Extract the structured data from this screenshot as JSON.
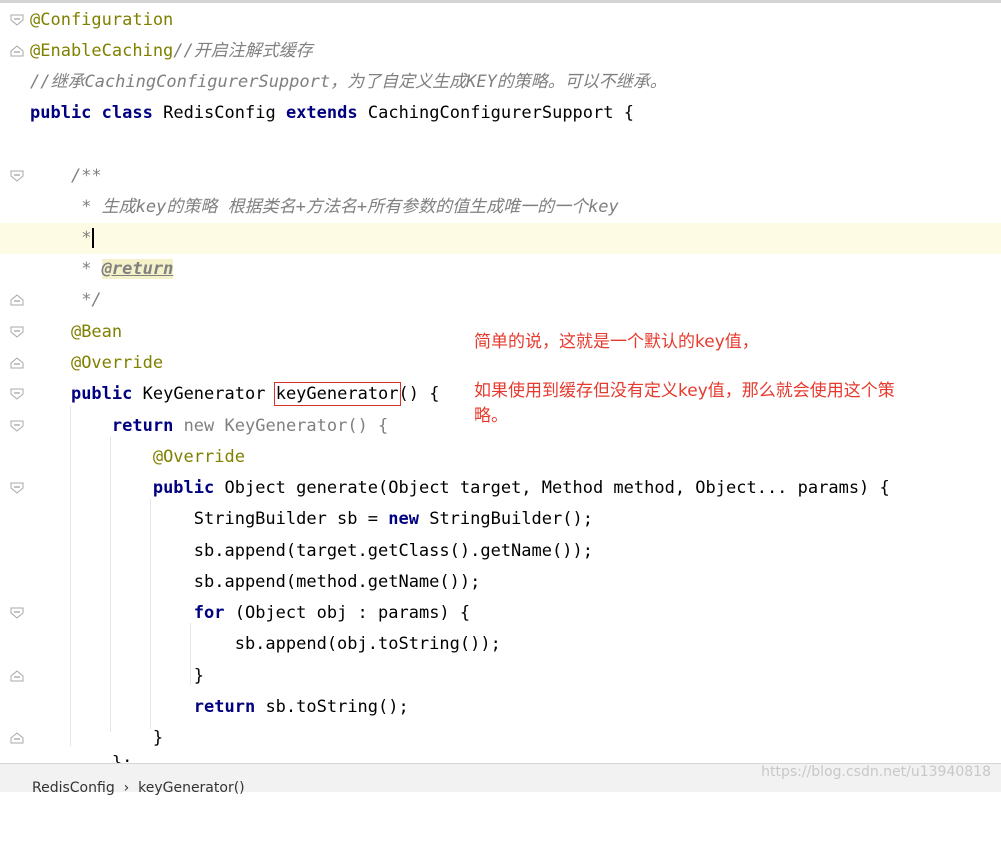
{
  "code_lines": [
    {
      "text": "@Configuration"
    },
    {
      "text": "@EnableCaching//开启注解式缓存"
    },
    {
      "text": "//继承CachingConfigurerSupport，为了自定义生成KEY的策略。可以不继承。"
    },
    {
      "text": "public class RedisConfig extends CachingConfigurerSupport {"
    },
    {
      "text": ""
    },
    {
      "text": "    /**"
    },
    {
      "text": "     * 生成key的策略 根据类名+方法名+所有参数的值生成唯一的一个key"
    },
    {
      "text": "     *"
    },
    {
      "text": "     * @return"
    },
    {
      "text": "     */"
    },
    {
      "text": "    @Bean"
    },
    {
      "text": "    @Override"
    },
    {
      "text": "    public KeyGenerator keyGenerator() {"
    },
    {
      "text": "        return new KeyGenerator() {"
    },
    {
      "text": "            @Override"
    },
    {
      "text": "            public Object generate(Object target, Method method, Object... params) {"
    },
    {
      "text": "                StringBuilder sb = new StringBuilder();"
    },
    {
      "text": "                sb.append(target.getClass().getName());"
    },
    {
      "text": "                sb.append(method.getName());"
    },
    {
      "text": "                for (Object obj : params) {"
    },
    {
      "text": "                    sb.append(obj.toString());"
    },
    {
      "text": "                }"
    },
    {
      "text": "                return sb.toString();"
    },
    {
      "text": "            }"
    },
    {
      "text": "        };"
    }
  ],
  "tokens": {
    "l1_annot": "@Configuration",
    "l2_annot": "@EnableCaching",
    "l2_comment": "//开启注解式缓存",
    "l3_comment": "//继承CachingConfigurerSupport，为了自定义生成KEY的策略。可以不继承。",
    "kw_public": "public",
    "kw_class": "class",
    "kw_extends": "extends",
    "kw_return": "return",
    "kw_new": "new",
    "kw_for": "for",
    "class_name": "RedisConfig",
    "super_name": "CachingConfigurerSupport",
    "brace_open": " {",
    "doc_open": "/**",
    "doc_line1": "* 生成key的策略 根据类名+方法名+所有参数的值生成唯一的一个key",
    "doc_star": "*",
    "doc_tag": "@return",
    "doc_close": "*/",
    "ann_bean": "@Bean",
    "ann_override": "@Override",
    "type_keygen": "KeyGenerator",
    "method_keygen": "keyGenerator",
    "parens_brace": "() {",
    "anon_ctor": "KeyGenerator() {",
    "generate_sig": "Object generate(Object target, Method method, Object... params) {",
    "sb_decl": "StringBuilder sb = ",
    "sb_ctor": "StringBuilder();",
    "append_class": "sb.append(target.getClass().getName());",
    "append_method": "sb.append(method.getName());",
    "for_body": "(Object obj : params) {",
    "append_obj": "sb.append(obj.toString());",
    "close_brace": "}",
    "return_sb": "sb.toString();",
    "close_anon": "};"
  },
  "annotation": {
    "line1": "简单的说，这就是一个默认的key值，",
    "line2": "如果使用到缓存但没有定义key值，那么就会使用这个策",
    "line3": "略。",
    "color": "#e63a2e"
  },
  "statusbar": {
    "breadcrumb": "RedisConfig  ›  keyGenerator()",
    "watermark": "https://blog.csdn.net/u13940818"
  },
  "colors": {
    "keyword": "#000080",
    "annotation": "#808000",
    "comment": "#808080",
    "current_line": "#fdfbe4",
    "highlight_box": "#d9302a"
  }
}
